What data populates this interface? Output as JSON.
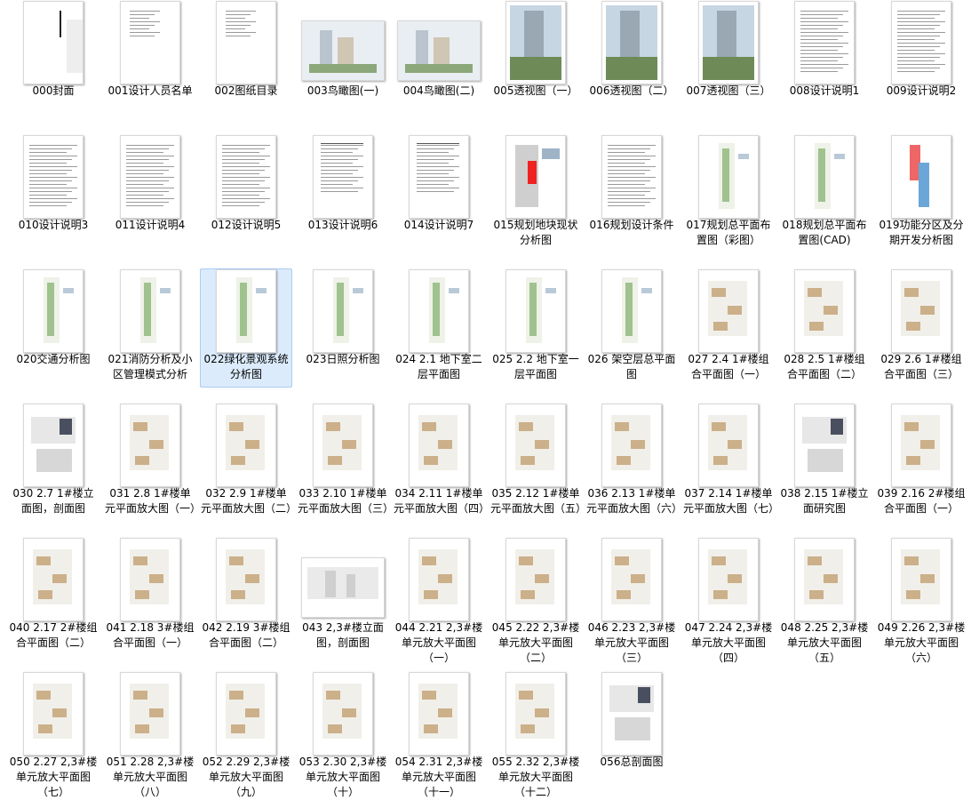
{
  "files": [
    {
      "label": "000封面",
      "kind": "cover"
    },
    {
      "label": "001设计人员名单",
      "kind": "list"
    },
    {
      "label": "002图纸目录",
      "kind": "list"
    },
    {
      "label": "003鸟瞰图(一)",
      "kind": "aerial"
    },
    {
      "label": "004鸟瞰图(二)",
      "kind": "aerial"
    },
    {
      "label": "005透视图（一）",
      "kind": "photo"
    },
    {
      "label": "006透视图（二）",
      "kind": "photo"
    },
    {
      "label": "007透视图（三）",
      "kind": "photo"
    },
    {
      "label": "008设计说明1",
      "kind": "text"
    },
    {
      "label": "009设计说明2",
      "kind": "text"
    },
    {
      "label": "010设计说明3",
      "kind": "text"
    },
    {
      "label": "011设计说明4",
      "kind": "text"
    },
    {
      "label": "012设计说明5",
      "kind": "text"
    },
    {
      "label": "013设计说明6",
      "kind": "table"
    },
    {
      "label": "014设计说明7",
      "kind": "table"
    },
    {
      "label": "015规划地块现状分析图",
      "kind": "site"
    },
    {
      "label": "016规划设计条件",
      "kind": "text"
    },
    {
      "label": "017规划总平面布置图（彩图）",
      "kind": "plan"
    },
    {
      "label": "018规划总平面布置图(CAD)",
      "kind": "plan"
    },
    {
      "label": "019功能分区及分期开发分析图",
      "kind": "zone"
    },
    {
      "label": "020交通分析图",
      "kind": "plan"
    },
    {
      "label": "021消防分析及小区管理模式分析",
      "kind": "plan"
    },
    {
      "label": "022绿化景观系统分析图",
      "kind": "plan",
      "selected": true
    },
    {
      "label": "023日照分析图",
      "kind": "plan"
    },
    {
      "label": "024 2.1  地下室二层平面图",
      "kind": "plan"
    },
    {
      "label": "025 2.2 地下室一层平面图",
      "kind": "plan"
    },
    {
      "label": "026 架空层总平面图",
      "kind": "plan"
    },
    {
      "label": "027  2.4  1#楼组合平面图（一）",
      "kind": "floor"
    },
    {
      "label": "028  2.5  1#楼组合平面图（二）",
      "kind": "floor"
    },
    {
      "label": "029  2.6  1#楼组合平面图（三）",
      "kind": "floor"
    },
    {
      "label": "030  2.7  1#楼立面图，剖面图",
      "kind": "elev"
    },
    {
      "label": "031  2.8  1#楼单元平面放大图（一）",
      "kind": "floor"
    },
    {
      "label": "032  2.9  1#楼单元平面放大图（二）",
      "kind": "floor"
    },
    {
      "label": "033  2.10  1#楼单元平面放大图（三）",
      "kind": "floor"
    },
    {
      "label": "034  2.11  1#楼单元平面放大图（四）",
      "kind": "floor"
    },
    {
      "label": "035  2.12  1#楼单元平面放大图（五）",
      "kind": "floor"
    },
    {
      "label": "036  2.13  1#楼单元平面放大图（六）",
      "kind": "floor"
    },
    {
      "label": "037  2.14  1#楼单元平面放大图（七）",
      "kind": "floor"
    },
    {
      "label": "038  2.15  1#楼立面研究图",
      "kind": "elev"
    },
    {
      "label": "039  2.16  2#楼组合平面图（一）",
      "kind": "floor"
    },
    {
      "label": "040  2.17  2#楼组合平面图（二）",
      "kind": "floor"
    },
    {
      "label": "041  2.18  3#楼组合平面图（一）",
      "kind": "floor"
    },
    {
      "label": "042  2.19  3#楼组合平面图（二）",
      "kind": "floor"
    },
    {
      "label": "043 2,3#楼立面图，剖面图",
      "kind": "elevland"
    },
    {
      "label": "044  2.21  2,3#楼单元放大平面图（一）",
      "kind": "floor"
    },
    {
      "label": "045  2.22  2,3#楼单元放大平面图（二）",
      "kind": "floor"
    },
    {
      "label": "046  2.23  2,3#楼单元放大平面图（三）",
      "kind": "floor"
    },
    {
      "label": "047  2.24  2,3#楼单元放大平面图（四）",
      "kind": "floor"
    },
    {
      "label": "048  2.25  2,3#楼单元放大平面图（五）",
      "kind": "floor"
    },
    {
      "label": "049  2.26  2,3#楼单元放大平面图（六）",
      "kind": "floor"
    },
    {
      "label": "050  2.27  2,3#楼单元放大平面图（七）",
      "kind": "floor"
    },
    {
      "label": "051  2.28  2,3#楼单元放大平面图（八）",
      "kind": "floor"
    },
    {
      "label": "052  2.29  2,3#楼单元放大平面图（九）",
      "kind": "floor"
    },
    {
      "label": "053  2.30  2,3#楼单元放大平面图（十）",
      "kind": "floor"
    },
    {
      "label": "054  2.31  2,3#楼单元放大平面图（十一）",
      "kind": "floor"
    },
    {
      "label": "055  2.32  2,3#楼单元放大平面图（十二）",
      "kind": "floor"
    },
    {
      "label": "056总剖面图",
      "kind": "elev"
    }
  ]
}
